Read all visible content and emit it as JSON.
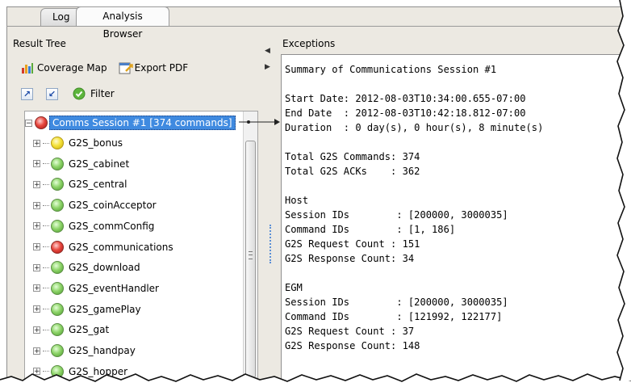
{
  "tabs": [
    {
      "label": "Log"
    },
    {
      "label": "Analysis Browser"
    }
  ],
  "left_panel": {
    "title": "Result Tree",
    "toolbar": {
      "coverage_map_label": "Coverage Map",
      "export_pdf_label": "Export PDF",
      "filter_label": "Filter"
    },
    "tree": {
      "root": {
        "label": "Comms Session #1 [374 commands]",
        "status": "red"
      },
      "items": [
        {
          "label": "G2S_bonus",
          "status": "yellow"
        },
        {
          "label": "G2S_cabinet",
          "status": "green"
        },
        {
          "label": "G2S_central",
          "status": "green"
        },
        {
          "label": "G2S_coinAcceptor",
          "status": "green"
        },
        {
          "label": "G2S_commConfig",
          "status": "green"
        },
        {
          "label": "G2S_communications",
          "status": "red"
        },
        {
          "label": "G2S_download",
          "status": "green"
        },
        {
          "label": "G2S_eventHandler",
          "status": "green"
        },
        {
          "label": "G2S_gamePlay",
          "status": "green"
        },
        {
          "label": "G2S_gat",
          "status": "green"
        },
        {
          "label": "G2S_handpay",
          "status": "green"
        },
        {
          "label": "G2S_hopper",
          "status": "green"
        }
      ]
    }
  },
  "right_panel": {
    "title": "Exceptions",
    "lines": [
      "Summary of Communications Session #1",
      "",
      "Start Date: 2012-08-03T10:34:00.655-07:00",
      "End Date  : 2012-08-03T10:42:18.812-07:00",
      "Duration  : 0 day(s), 0 hour(s), 8 minute(s)",
      "",
      "Total G2S Commands: 374",
      "Total G2S ACKs    : 362",
      "",
      "Host",
      "Session IDs        : [200000, 3000035]",
      "Command IDs        : [1, 186]",
      "G2S Request Count : 151",
      "G2S Response Count: 34",
      "",
      "EGM",
      "Session IDs        : [200000, 3000035]",
      "Command IDs        : [121992, 122177]",
      "G2S Request Count : 37",
      "G2S Response Count: 148"
    ]
  },
  "colors": {
    "selection": "#3f8ae0",
    "status_green": "#8fd56b",
    "status_yellow": "#f5e23a",
    "status_red": "#e8483f"
  },
  "icons": [
    "coverage-map-icon",
    "export-pdf-icon",
    "expand-all-icon",
    "collapse-all-icon",
    "filter-check-icon",
    "expand-toggle-icon",
    "status-ball-icon"
  ]
}
